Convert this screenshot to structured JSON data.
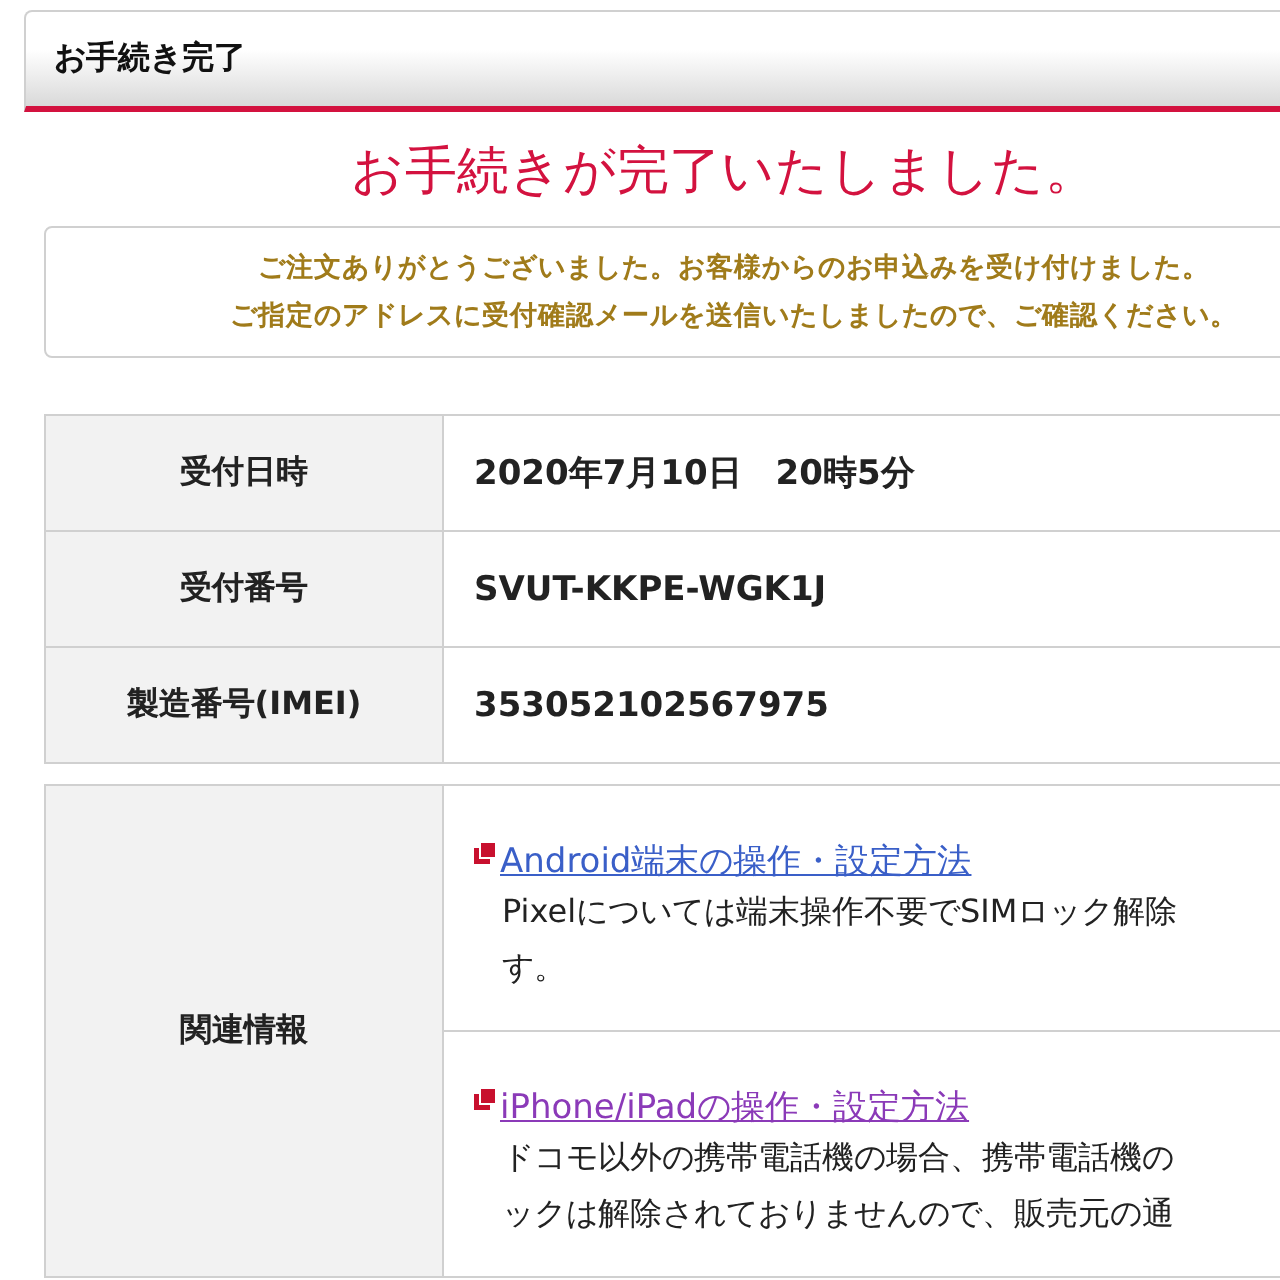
{
  "header": {
    "title": "お手続き完了"
  },
  "heading": "お手続きが完了いたしました。",
  "notice": {
    "lines": [
      "ご注文ありがとうございました。お客様からのお申込みを受け付けました。",
      "ご指定のアドレスに受付確認メールを送信いたしましたので、ご確認ください。"
    ]
  },
  "details": [
    {
      "label": "受付日時",
      "value": "2020年7月10日　20時5分"
    },
    {
      "label": "受付番号",
      "value": "SVUT-KKPE-WGK1J"
    },
    {
      "label": "製造番号(IMEI)",
      "value": "353052102567975"
    }
  ],
  "related": {
    "label": "関連情報",
    "items": [
      {
        "link": "Android端末の操作・設定方法",
        "visited": false,
        "lines": [
          "Pixelについては端末操作不要でSIMロック解除",
          "す。"
        ]
      },
      {
        "link": "iPhone/iPadの操作・設定方法",
        "visited": true,
        "lines": [
          "ドコモ以外の携帯電話機の場合、携帯電話機の",
          "ックは解除されておりませんので、販売元の通"
        ]
      }
    ]
  }
}
